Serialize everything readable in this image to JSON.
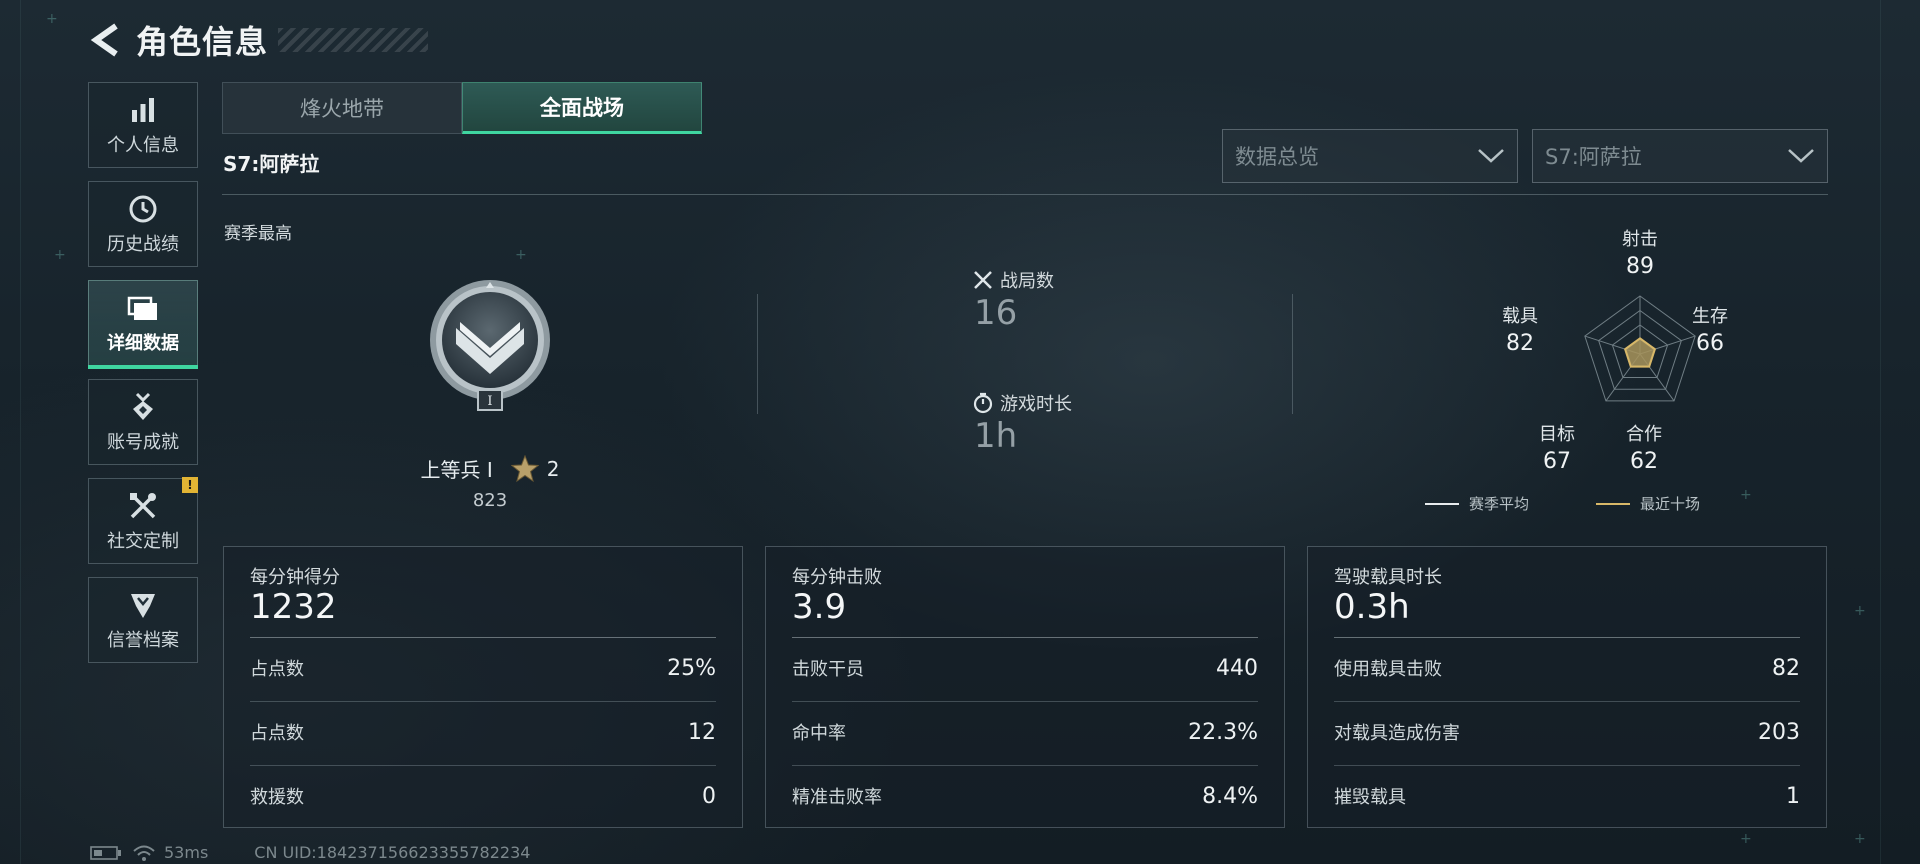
{
  "header": {
    "title": "角色信息"
  },
  "sidebar": {
    "items": [
      {
        "label": "个人信息",
        "icon": "bar-chart-icon"
      },
      {
        "label": "历史战绩",
        "icon": "history-clock-icon"
      },
      {
        "label": "详细数据",
        "icon": "folder-icon",
        "active": true
      },
      {
        "label": "账号成就",
        "icon": "medal-icon"
      },
      {
        "label": "社交定制",
        "icon": "tools-icon",
        "badge": "!"
      },
      {
        "label": "信誉档案",
        "icon": "shield-icon"
      }
    ]
  },
  "mode_tabs": [
    {
      "label": "烽火地带",
      "active": false
    },
    {
      "label": "全面战场",
      "active": true
    }
  ],
  "season_label": "S7:阿萨拉",
  "dropdowns": {
    "category": {
      "value": "数据总览"
    },
    "season": {
      "value": "S7:阿萨拉"
    }
  },
  "season_best": {
    "label": "赛季最高",
    "rank_name": "上等兵 I",
    "stars": "2",
    "points": "823",
    "emblem_tier": "I"
  },
  "battle_stats": {
    "matches": {
      "label": "战局数",
      "value": "16"
    },
    "playtime": {
      "label": "游戏时长",
      "value": "1h"
    }
  },
  "radar": {
    "axes": [
      {
        "label": "射击",
        "value": "89"
      },
      {
        "label": "生存",
        "value": "66"
      },
      {
        "label": "合作",
        "value": "62"
      },
      {
        "label": "目标",
        "value": "67"
      },
      {
        "label": "载具",
        "value": "82"
      }
    ],
    "recent_fraction": [
      0.27,
      0.27,
      0.27,
      0.27,
      0.27
    ],
    "legend": {
      "season_avg": "赛季平均",
      "recent_ten": "最近十场"
    },
    "colors": {
      "grid": "#6f7d84",
      "season_avg": "#e8ecee",
      "recent": "#d8b868",
      "fill": "#a8945c"
    }
  },
  "cards": [
    {
      "title": "每分钟得分",
      "value": "1232",
      "rows": [
        {
          "label": "占点数",
          "value": "25%"
        },
        {
          "label": "占点数",
          "value": "12"
        },
        {
          "label": "救援数",
          "value": "0"
        }
      ]
    },
    {
      "title": "每分钟击败",
      "value": "3.9",
      "rows": [
        {
          "label": "击败干员",
          "value": "440"
        },
        {
          "label": "命中率",
          "value": "22.3%"
        },
        {
          "label": "精准击败率",
          "value": "8.4%"
        }
      ]
    },
    {
      "title": "驾驶载具时长",
      "value": "0.3h",
      "rows": [
        {
          "label": "使用载具击败",
          "value": "82"
        },
        {
          "label": "对载具造成伤害",
          "value": "203"
        },
        {
          "label": "摧毁载具",
          "value": "1"
        }
      ]
    }
  ],
  "status_bar": {
    "latency": "53ms",
    "uid": "CN UID:18423715662335578223​4"
  },
  "colors": {
    "accent": "#3fd6a0",
    "badge": "#e2b434"
  }
}
